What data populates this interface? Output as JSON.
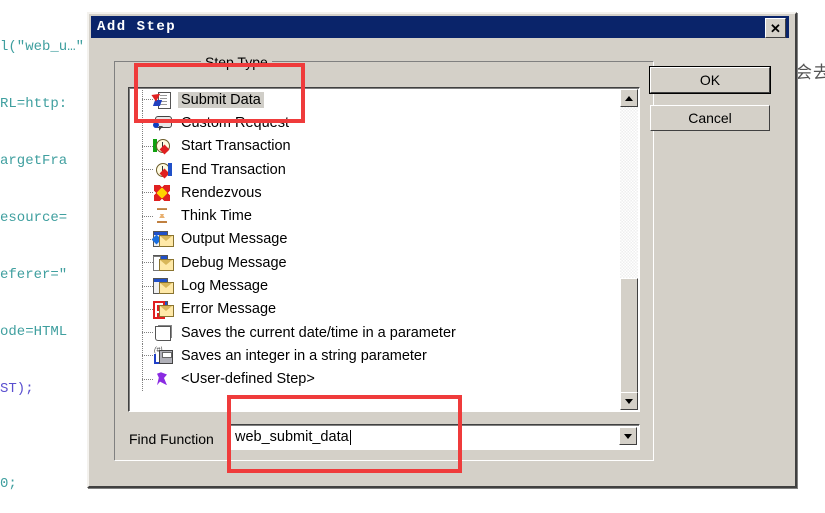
{
  "background_code": {
    "lines": [
      {
        "text": "l(\"web_u…\"",
        "kw": false
      },
      {
        "text": "RL=http:",
        "kw": false
      },
      {
        "text": "argetFra",
        "kw": false
      },
      {
        "text": "esource=",
        "kw": false
      },
      {
        "text": "eferer=\"",
        "kw": false
      },
      {
        "text": "ode=HTML",
        "kw": false
      },
      {
        "text": "ST);",
        "kw": true
      },
      {
        "text": "",
        "kw": false
      },
      {
        "text": "0;",
        "kw": false
      }
    ],
    "side_text": "会去"
  },
  "dialog": {
    "title": "Add Step",
    "close_label": "✕",
    "group_legend": "Step Type",
    "buttons": {
      "ok": "OK",
      "cancel": "Cancel"
    },
    "find": {
      "label": "Find Function",
      "value": "web_submit_data",
      "placeholder": ""
    },
    "tree_items": [
      {
        "label": "Submit Data",
        "icon": "submit-data-icon",
        "selected": true
      },
      {
        "label": "Custom Request",
        "icon": "custom-request-icon",
        "selected": false
      },
      {
        "label": "Start Transaction",
        "icon": "start-transaction-icon",
        "selected": false
      },
      {
        "label": "End Transaction",
        "icon": "end-transaction-icon",
        "selected": false
      },
      {
        "label": "Rendezvous",
        "icon": "rendezvous-icon",
        "selected": false
      },
      {
        "label": "Think Time",
        "icon": "think-time-icon",
        "selected": false
      },
      {
        "label": "Output Message",
        "icon": "output-message-icon",
        "selected": false
      },
      {
        "label": "Debug Message",
        "icon": "debug-message-icon",
        "selected": false
      },
      {
        "label": "Log Message",
        "icon": "log-message-icon",
        "selected": false
      },
      {
        "label": "Error Message",
        "icon": "error-message-icon",
        "selected": false
      },
      {
        "label": "Saves the current date/time in a parameter",
        "icon": "save-datetime-icon",
        "selected": false
      },
      {
        "label": "Saves an integer in a string parameter",
        "icon": "save-integer-icon",
        "selected": false
      },
      {
        "label": "<User-defined Step>",
        "icon": "user-defined-step-icon",
        "selected": false
      }
    ]
  },
  "colors": {
    "title_bar": "#0a246a",
    "dialog_face": "#d4d0c8",
    "annotation": "#ef3b3b",
    "code_text": "#3f9f9f",
    "code_keyword": "#5a4fcf"
  }
}
